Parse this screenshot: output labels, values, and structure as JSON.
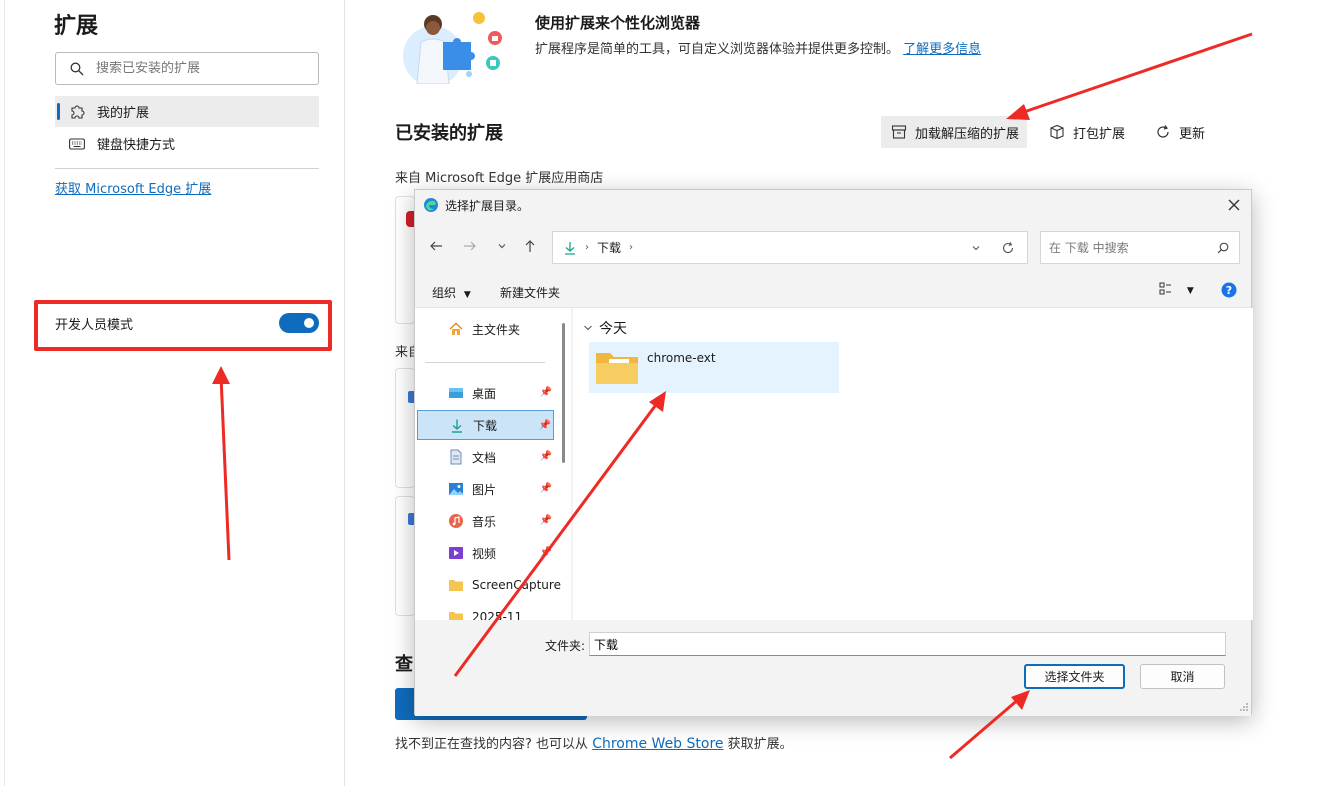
{
  "sidebar": {
    "title": "扩展",
    "search_placeholder": "搜索已安装的扩展",
    "items": [
      {
        "label": "我的扩展"
      },
      {
        "label": "键盘快捷方式"
      }
    ],
    "get_link": "获取 Microsoft Edge 扩展",
    "dev_mode_label": "开发人员模式",
    "dev_mode_on": true
  },
  "main": {
    "hero_title": "使用扩展来个性化浏览器",
    "hero_desc": "扩展程序是简单的工具，可自定义浏览器体验并提供更多控制。",
    "hero_link": "了解更多信息",
    "installed_title": "已安装的扩展",
    "actions": {
      "load_unpacked": "加载解压缩的扩展",
      "pack": "打包扩展",
      "update": "更新"
    },
    "from_store": "来自 Microsoft Edge 扩展应用商店",
    "from_other_partial": "来自",
    "find_partial": "查",
    "footer_prefix": "找不到正在查找的内容? 也可以从",
    "footer_link": "Chrome Web Store",
    "footer_suffix": "获取扩展。"
  },
  "dialog": {
    "title": "选择扩展目录。",
    "path": "下载",
    "search_placeholder": "在 下载 中搜索",
    "toolbar": {
      "organize": "组织",
      "new_folder": "新建文件夹"
    },
    "nav": {
      "home": "主文件夹",
      "items": [
        {
          "label": "桌面",
          "icon": "desktop-icon"
        },
        {
          "label": "下载",
          "icon": "download-icon"
        },
        {
          "label": "文档",
          "icon": "document-icon"
        },
        {
          "label": "图片",
          "icon": "picture-icon"
        },
        {
          "label": "音乐",
          "icon": "music-icon"
        },
        {
          "label": "视频",
          "icon": "video-icon"
        },
        {
          "label": "ScreenCapture",
          "icon": "folder-icon"
        },
        {
          "label": "2025-11",
          "icon": "folder-icon"
        }
      ]
    },
    "group_label": "今天",
    "folder_name": "chrome-ext",
    "folder_label": "文件夹:",
    "folder_value": "下载",
    "select_button": "选择文件夹",
    "cancel_button": "取消"
  },
  "colors": {
    "accent": "#0f6cbd",
    "highlight_red": "#ee2a24"
  }
}
